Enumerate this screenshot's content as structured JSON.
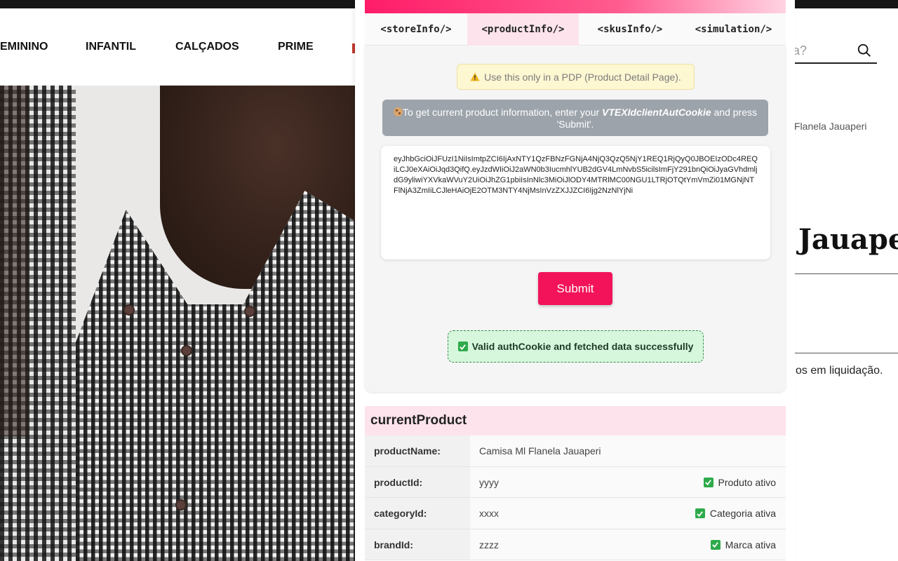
{
  "store": {
    "nav": [
      "EMININO",
      "INFANTIL",
      "CALÇADOS",
      "PRIME"
    ],
    "search_placeholder": "a?",
    "breadcrumb_tail": "Flanela Jauaperi",
    "product_title_partial": "Jauape",
    "sale_text": "os em liquidação."
  },
  "extension": {
    "tabs": [
      {
        "label": "<storeInfo/>",
        "active": false
      },
      {
        "label": "<productInfo/>",
        "active": true
      },
      {
        "label": "<skusInfo/>",
        "active": false
      },
      {
        "label": "<simulation/>",
        "active": false
      }
    ],
    "warning_text": "Use this only in a PDP (Product Detail Page).",
    "info_prefix": "To get current product information, enter your ",
    "info_cookie_name": "VTEXIdclientAutCookie",
    "info_suffix": " and press 'Submit'.",
    "token_value": "eyJhbGciOiJFUzI1NiIsImtpZCI6IjAxNTY1QzFBNzFGNjA4NjQ3QzQ5NjY1REQ1RjQyQ0JBOEIzODc4REQiLCJ0eXAiOiJqd3QifQ.eyJzdWIiOiJ2aWN0b3IucmhlYUB2dGV4LmNvbS5icilsImFjY291bnQiOiJyaGVhdmljdG9yliwiYXVkaWVuY2UiOiJhZG1pbiIsInNlc3MiOiJlODY4MTRlMC00NGU1LTRjOTQtYmVmZi01MGNjNTFlNjA3ZmIiLCJleHAiOjE2OTM3NTY4NjMsInVzZXJJZCI6Ijg2NzNlYjNi",
    "submit_label": "Submit",
    "success_text": "Valid authCookie and fetched data successfully",
    "current_product": {
      "title": "currentProduct",
      "rows": [
        {
          "key": "productName:",
          "value": "Camisa Ml Flanela Jauaperi",
          "flag": ""
        },
        {
          "key": "productId:",
          "value": "yyyy",
          "flag": "Produto ativo"
        },
        {
          "key": "categoryId:",
          "value": "xxxx",
          "flag": "Categoria ativa"
        },
        {
          "key": "brandId:",
          "value": "zzzz",
          "flag": "Marca ativa"
        }
      ]
    }
  }
}
